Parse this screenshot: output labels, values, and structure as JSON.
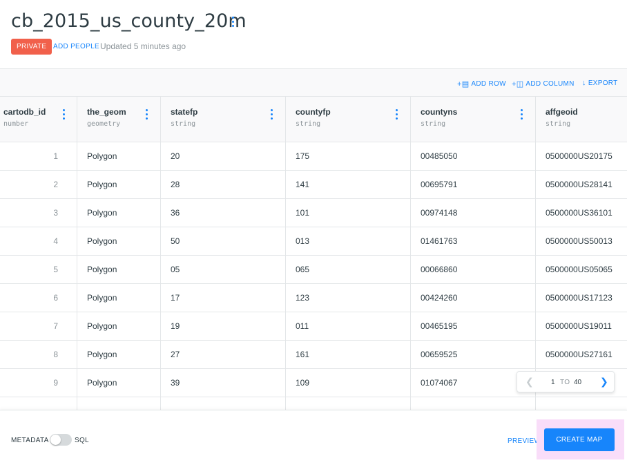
{
  "header": {
    "title": "cb_2015_us_county_20m",
    "privacy_badge": "PRIVATE",
    "add_people": "ADD PEOPLE",
    "updated": "Updated 5 minutes ago"
  },
  "toolbar": {
    "add_row": "ADD ROW",
    "add_column": "ADD COLUMN",
    "export": "EXPORT"
  },
  "table": {
    "columns": [
      {
        "name": "cartodb_id",
        "type": "number"
      },
      {
        "name": "the_geom",
        "type": "geometry"
      },
      {
        "name": "statefp",
        "type": "string"
      },
      {
        "name": "countyfp",
        "type": "string"
      },
      {
        "name": "countyns",
        "type": "string"
      },
      {
        "name": "affgeoid",
        "type": "string"
      }
    ],
    "rows": [
      [
        "1",
        "Polygon",
        "20",
        "175",
        "00485050",
        "0500000US20175"
      ],
      [
        "2",
        "Polygon",
        "28",
        "141",
        "00695791",
        "0500000US28141"
      ],
      [
        "3",
        "Polygon",
        "36",
        "101",
        "00974148",
        "0500000US36101"
      ],
      [
        "4",
        "Polygon",
        "50",
        "013",
        "01461763",
        "0500000US50013"
      ],
      [
        "5",
        "Polygon",
        "05",
        "065",
        "00066860",
        "0500000US05065"
      ],
      [
        "6",
        "Polygon",
        "17",
        "123",
        "00424260",
        "0500000US17123"
      ],
      [
        "7",
        "Polygon",
        "19",
        "011",
        "00465195",
        "0500000US19011"
      ],
      [
        "8",
        "Polygon",
        "27",
        "161",
        "00659525",
        "0500000US27161"
      ],
      [
        "9",
        "Polygon",
        "39",
        "109",
        "01074067",
        ""
      ]
    ]
  },
  "pagination": {
    "from": "1",
    "to_label": "TO",
    "total": "40"
  },
  "footer": {
    "metadata_label": "METADATA",
    "sql_label": "SQL",
    "preview": "PREVIEW",
    "create_map": "CREATE MAP"
  },
  "colors": {
    "accent": "#1785fb",
    "private_badge": "#f1604b",
    "highlight": "#f9ddf9"
  }
}
